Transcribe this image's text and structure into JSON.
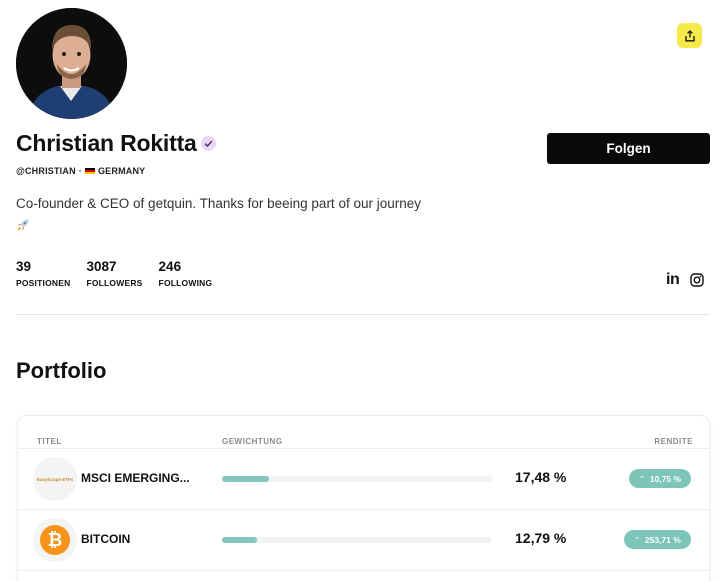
{
  "profile": {
    "name": "Christian Rokitta",
    "handle": "@CHRISTIAN",
    "separator": "·",
    "country": "GERMANY",
    "bio": "Co-founder & CEO of getquin. Thanks for beeing part of our journey",
    "follow_label": "Folgen"
  },
  "stats": [
    {
      "value": "39",
      "label": "POSITIONEN"
    },
    {
      "value": "3087",
      "label": "FOLLOWERS"
    },
    {
      "value": "246",
      "label": "FOLLOWING"
    }
  ],
  "social": {
    "linkedin": "in",
    "instagram_icon": "instagram-icon"
  },
  "portfolio": {
    "title": "Portfolio",
    "columns": {
      "title": "TITEL",
      "weight": "GEWICHTUNG",
      "return": "RENDITE"
    },
    "rows": [
      {
        "name": "MSCI EMERGING...",
        "logo_text": "EasyScope ETFs",
        "weight": "17,48 %",
        "weight_fraction": 0.1748,
        "return": "10,75 %"
      },
      {
        "name": "BITCOIN",
        "logo_icon": "bitcoin-icon",
        "weight": "12,79 %",
        "weight_fraction": 0.1279,
        "return": "253,71 %"
      }
    ]
  },
  "colors": {
    "accent_yellow": "#f6e94a",
    "teal": "#7cc5b8",
    "bitcoin_orange": "#f7931a"
  }
}
